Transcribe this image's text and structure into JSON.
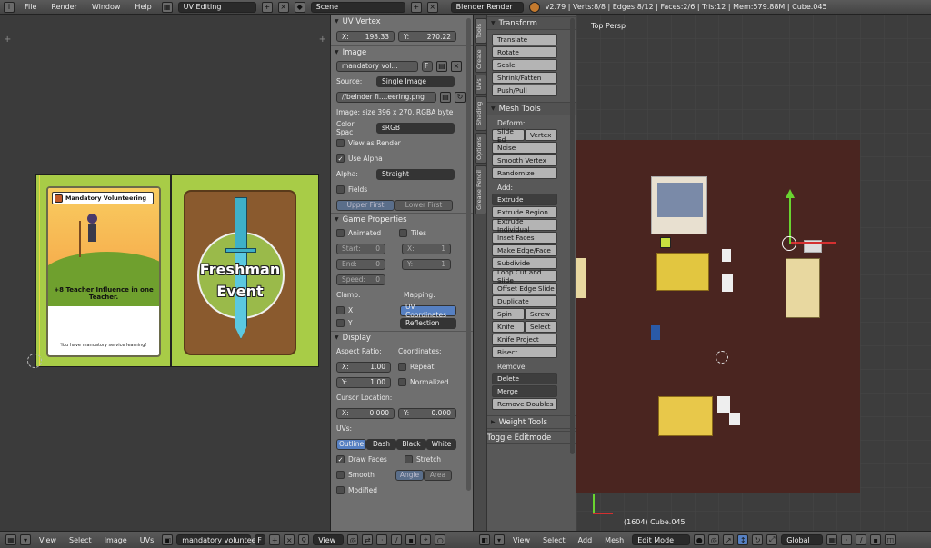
{
  "topbar": {
    "menus": [
      "File",
      "Render",
      "Window",
      "Help"
    ],
    "screen_layout": "UV Editing",
    "scene": "Scene",
    "engine": "Blender Render",
    "stats": "v2.79 | Verts:8/8 | Edges:8/12 | Faces:2/6 | Tris:12 | Mem:579.88M | Cube.045"
  },
  "uv": {
    "card1_title": "Mandatory Volunteering",
    "card1_body": "+8 Teacher Influence in one Teacher.",
    "card1_footer": "You have mandatory service learning!",
    "card2_text1": "Freshman",
    "card2_text2": "Event"
  },
  "props": {
    "uv_vertex": {
      "title": "UV Vertex",
      "x_label": "X:",
      "x_value": "198.33",
      "y_label": "Y:",
      "y_value": "270.22"
    },
    "image": {
      "title": "Image",
      "name": "mandatory vol...",
      "f_label": "F",
      "source_label": "Source:",
      "source_value": "Single Image",
      "path": "//belnder fi....eering.png",
      "info": "Image: size 396 x 270, RGBA byte",
      "colorspace_label": "Color Spac",
      "colorspace_value": "sRGB",
      "view_as_render": "View as Render",
      "use_alpha": "Use Alpha",
      "alpha_label": "Alpha:",
      "alpha_value": "Straight",
      "fields": "Fields",
      "upper_first": "Upper First",
      "lower_first": "Lower First"
    },
    "game": {
      "title": "Game Properties",
      "animated": "Animated",
      "tiles": "Tiles",
      "start_label": "Start:",
      "start_value": "0",
      "x_label": "X:",
      "x_value": "1",
      "end_label": "End:",
      "end_value": "0",
      "y_label": "Y:",
      "y_value": "1",
      "speed_label": "Speed:",
      "speed_value": "0",
      "clamp": "Clamp:",
      "mapping": "Mapping:",
      "clamp_x": "X",
      "clamp_y": "Y",
      "uv_coordinates": "UV Coordinates",
      "reflection": "Reflection"
    },
    "display": {
      "title": "Display",
      "aspect_label": "Aspect Ratio:",
      "coords_label": "Coordinates:",
      "ax_label": "X:",
      "ax_value": "1.00",
      "ay_label": "Y:",
      "ay_value": "1.00",
      "repeat": "Repeat",
      "normalized": "Normalized",
      "cursor_label": "Cursor Location:",
      "cx_label": "X:",
      "cx_value": "0.000",
      "cy_label": "Y:",
      "cy_value": "0.000",
      "uvs_label": "UVs:",
      "outline": "Outline",
      "dash": "Dash",
      "black": "Black",
      "white": "White",
      "draw_faces": "Draw Faces",
      "stretch": "Stretch",
      "smooth": "Smooth",
      "angle": "Angle",
      "area": "Area",
      "modified": "Modified"
    }
  },
  "tabs": [
    "Tools",
    "Create",
    "UVs",
    "Shading",
    "Options",
    "Grease Pencil"
  ],
  "tools": {
    "transform_title": "Transform",
    "transform": [
      "Translate",
      "Rotate",
      "Scale",
      "Shrink/Fatten",
      "Push/Pull"
    ],
    "mesh_title": "Mesh Tools",
    "deform_label": "Deform:",
    "slide_edge": "Slide Ed",
    "vertex": "Vertex",
    "noise": "Noise",
    "smooth_vertex": "Smooth Vertex",
    "randomize": "Randomize",
    "add_label": "Add:",
    "extrude": "Extrude",
    "add_items": [
      "Extrude Region",
      "Extrude Individual",
      "Inset Faces",
      "Make Edge/Face",
      "Subdivide",
      "Loop Cut and Slide",
      "Offset Edge Slide",
      "Duplicate"
    ],
    "spin": "Spin",
    "screw": "Screw",
    "knife": "Knife",
    "select": "Select",
    "knife_project": "Knife Project",
    "bisect": "Bisect",
    "remove_label": "Remove:",
    "delete": "Delete",
    "merge": "Merge",
    "remove_doubles": "Remove Doubles",
    "weight_title": "Weight Tools",
    "toggle_editmode": "Toggle Editmode"
  },
  "view3d": {
    "label": "Top Persp",
    "object_info": "(1604) Cube.045"
  },
  "bottom_left": {
    "menus": [
      "View",
      "Select",
      "Image",
      "UVs"
    ],
    "image_name": "mandatory voluntee...",
    "f_label": "F",
    "view": "View"
  },
  "bottom_right": {
    "menus": [
      "View",
      "Select",
      "Add",
      "Mesh"
    ],
    "mode": "Edit Mode",
    "orientation": "Global"
  },
  "colors": {
    "selected": "#5680c2",
    "card_green": "#a8cc47",
    "card_brown": "#8a5a2e",
    "floor": "#4a2520"
  }
}
